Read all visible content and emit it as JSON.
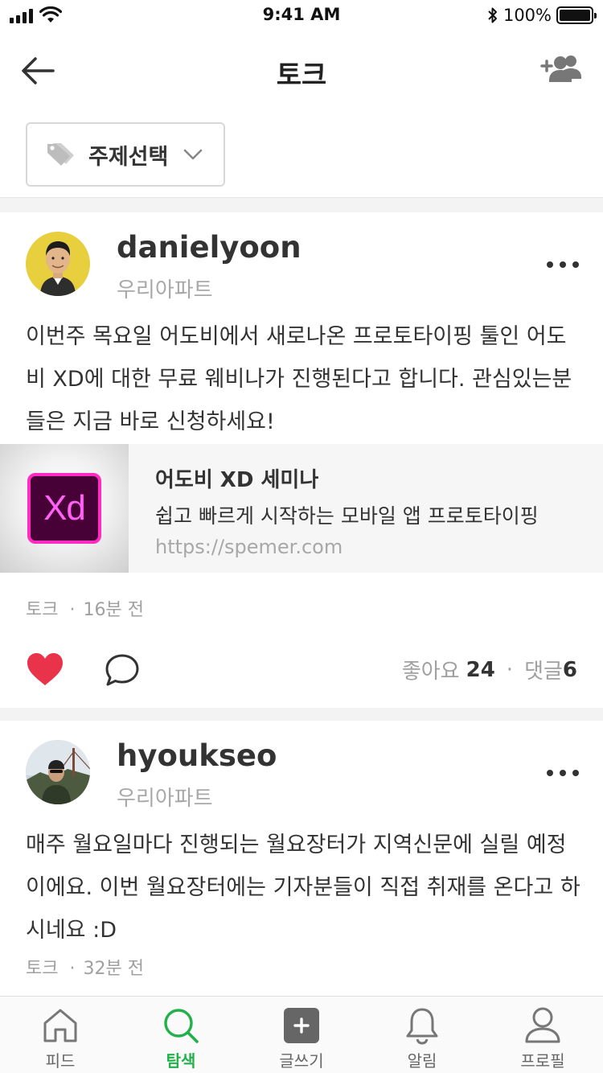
{
  "status_bar": {
    "time": "9:41 AM",
    "battery": "100%"
  },
  "header": {
    "title": "토크"
  },
  "topic_filter": {
    "label": "주제선택"
  },
  "posts": [
    {
      "author": "danielyoon",
      "location": "우리아파트",
      "text": "이번주 목요일 어도비에서 새로나온 프로토타이핑 툴인 어도비 XD에 대한 무료 웨비나가 진행된다고 합니다. 관심있는분들은 지금 바로 신청하세요!",
      "link": {
        "logo_text": "Xd",
        "title": "어도비 XD 세미나",
        "description": "쉽고 빠르게 시작하는 모바일 앱 프로토타이핑",
        "url": "https://spemer.com"
      },
      "category": "토크",
      "time": "16분 전",
      "likes_label": "좋아요",
      "likes_count": "24",
      "comments_label": "댓글",
      "comments_count": "6"
    },
    {
      "author": "hyoukseo",
      "location": "우리아파트",
      "text": "매주 월요일마다 진행되는 월요장터가 지역신문에 실릴 예정이에요. 이번 월요장터에는 기자분들이 직접 취재를 온다고 하시네요 :D",
      "category": "토크",
      "time": "32분 전"
    }
  ],
  "tab_bar": {
    "items": [
      {
        "label": "피드",
        "icon": "home-icon"
      },
      {
        "label": "탐색",
        "icon": "search-icon"
      },
      {
        "label": "글쓰기",
        "icon": "plus-square-icon"
      },
      {
        "label": "알림",
        "icon": "bell-icon"
      },
      {
        "label": "프로필",
        "icon": "person-icon"
      }
    ],
    "active_index": 1
  },
  "colors": {
    "accent_green": "#22b04b",
    "like_red": "#e8334a",
    "text_dark": "#333333",
    "text_gray": "#a8a8a8"
  }
}
